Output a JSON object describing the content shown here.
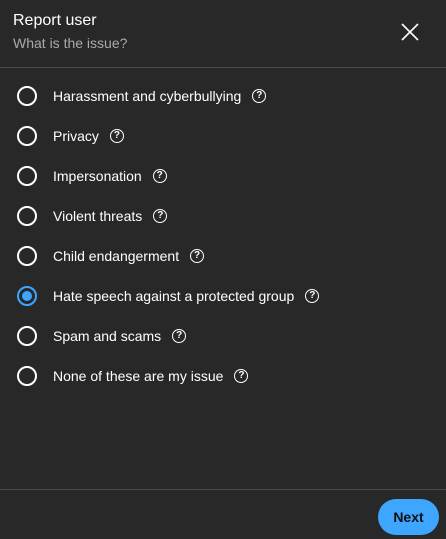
{
  "header": {
    "title": "Report user",
    "subtitle": "What is the issue?",
    "close_icon": "close-icon"
  },
  "options": [
    {
      "label": "Harassment and cyberbullying",
      "selected": false
    },
    {
      "label": "Privacy",
      "selected": false
    },
    {
      "label": "Impersonation",
      "selected": false
    },
    {
      "label": "Violent threats",
      "selected": false
    },
    {
      "label": "Child endangerment",
      "selected": false
    },
    {
      "label": "Hate speech against a protected group",
      "selected": true
    },
    {
      "label": "Spam and scams",
      "selected": false
    },
    {
      "label": "None of these are my issue",
      "selected": false
    }
  ],
  "help_glyph": "?",
  "footer": {
    "next_label": "Next"
  },
  "colors": {
    "background": "#282828",
    "accent": "#3ea6ff",
    "text": "#ffffff",
    "muted": "#aaaaaa"
  }
}
